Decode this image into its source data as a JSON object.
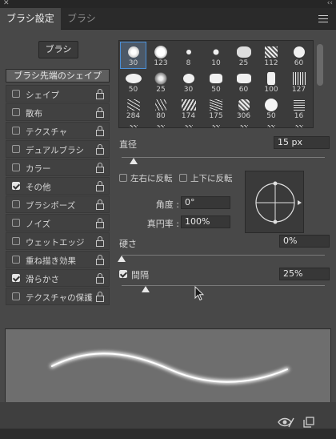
{
  "window": {
    "close_glyph": "✕",
    "collapse_glyph": "‹‹"
  },
  "tabs": [
    {
      "label": "ブラシ設定",
      "active": true
    },
    {
      "label": "ブラシ",
      "active": false
    }
  ],
  "brushes_button": "ブラシ",
  "brush_tip_shape_label": "ブラシ先端のシェイプ",
  "options": [
    {
      "label": "シェイプ",
      "checked": false
    },
    {
      "label": "散布",
      "checked": false
    },
    {
      "label": "テクスチャ",
      "checked": false
    },
    {
      "label": "デュアルブラシ",
      "checked": false
    },
    {
      "label": "カラー",
      "checked": false
    },
    {
      "label": "その他",
      "checked": true
    },
    {
      "label": "ブラシポーズ",
      "checked": false
    },
    {
      "label": "ノイズ",
      "checked": false
    },
    {
      "label": "ウェットエッジ",
      "checked": false
    },
    {
      "label": "重ね描き効果",
      "checked": false
    },
    {
      "label": "滑らかさ",
      "checked": true
    },
    {
      "label": "テクスチャの保護",
      "checked": false
    }
  ],
  "presets": [
    {
      "size": "30",
      "selected": true
    },
    {
      "size": "123"
    },
    {
      "size": "8"
    },
    {
      "size": "10"
    },
    {
      "size": "25"
    },
    {
      "size": "112"
    },
    {
      "size": "60"
    },
    {
      "size": "50"
    },
    {
      "size": "25"
    },
    {
      "size": "30"
    },
    {
      "size": "50"
    },
    {
      "size": "60"
    },
    {
      "size": "100"
    },
    {
      "size": "127"
    },
    {
      "size": "284"
    },
    {
      "size": "80"
    },
    {
      "size": "174"
    },
    {
      "size": "175"
    },
    {
      "size": "306"
    },
    {
      "size": "50"
    },
    {
      "size": "16"
    }
  ],
  "diameter": {
    "label": "直径",
    "value": "15 px",
    "level": 0.06
  },
  "flip_x": {
    "label": "左右に反転",
    "checked": false
  },
  "flip_y": {
    "label": "上下に反転",
    "checked": false
  },
  "angle": {
    "label": "角度 :",
    "value": "0°"
  },
  "roundness": {
    "label": "真円率 :",
    "value": "100%"
  },
  "hardness": {
    "label": "硬さ",
    "value": "0%",
    "level": 0.0
  },
  "spacing": {
    "label": "間隔",
    "value": "25%",
    "checked": true,
    "level": 0.12
  },
  "footer": {
    "eye_icon": "eye-slash-icon",
    "new_icon": "new-preset-icon"
  }
}
